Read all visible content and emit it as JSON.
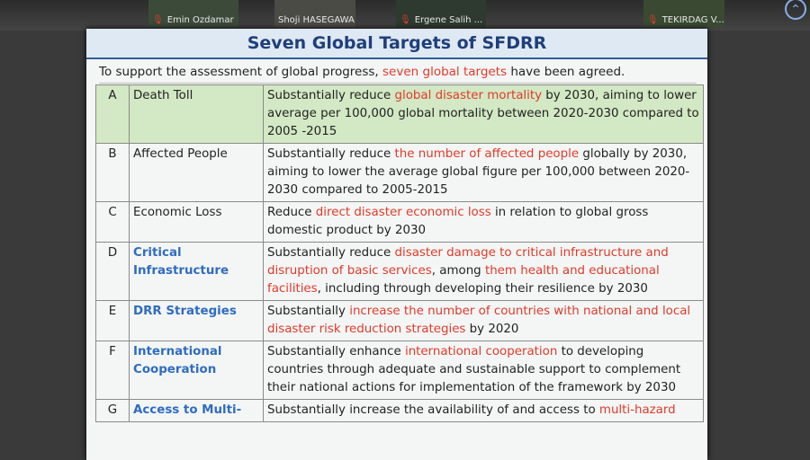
{
  "participants": [
    {
      "name": "Emin Ozdamar"
    },
    {
      "name": "Shoji HASEGAWA"
    },
    {
      "name": "Ergene Salih ..."
    },
    {
      "name": "TEKIRDAG V..."
    }
  ],
  "slide": {
    "title": "Seven Global Targets of SFDRR",
    "subtitle_a": "To support the assessment of global progress, ",
    "subtitle_b": "seven global targets",
    "subtitle_c": " have been agreed.",
    "rows": [
      {
        "letter": "A",
        "name": "Death Toll",
        "parts": [
          [
            "Substantially reduce ",
            ""
          ],
          [
            "global disaster mortality",
            "red"
          ],
          [
            " by 2030, aiming to lower average per 100,000 global mortality between 2020-2030 compared to 2005 -2015",
            ""
          ]
        ]
      },
      {
        "letter": "B",
        "name": "Affected People",
        "parts": [
          [
            "Substantially reduce ",
            ""
          ],
          [
            "the number of affected people",
            "red"
          ],
          [
            " globally by 2030, aiming to lower the average global figure per 100,000 between 2020-2030 compared to 2005-2015",
            ""
          ]
        ]
      },
      {
        "letter": "C",
        "name": "Economic Loss",
        "parts": [
          [
            "Reduce ",
            ""
          ],
          [
            "direct disaster economic loss",
            "red"
          ],
          [
            " in relation to global gross domestic product by 2030",
            ""
          ]
        ]
      },
      {
        "letter": "D",
        "name": "Critical Infrastructure",
        "parts": [
          [
            "Substantially reduce ",
            ""
          ],
          [
            "disaster damage to critical infrastructure and disruption of basic services",
            "red"
          ],
          [
            ", among ",
            ""
          ],
          [
            "them health and educational facilities",
            "red"
          ],
          [
            ", including through developing their resilience by 2030",
            ""
          ]
        ]
      },
      {
        "letter": "E",
        "name": "DRR Strategies",
        "parts": [
          [
            "Substantially ",
            ""
          ],
          [
            "increase the number of countries with national and local disaster risk reduction strategies",
            "red"
          ],
          [
            " by 2020",
            ""
          ]
        ]
      },
      {
        "letter": "F",
        "name": "International Cooperation",
        "parts": [
          [
            "Substantially enhance ",
            ""
          ],
          [
            "international cooperation",
            "red"
          ],
          [
            " to developing countries through adequate and sustainable support to complement their national actions for implementation of the framework by 2030",
            ""
          ]
        ]
      },
      {
        "letter": "G",
        "name": "Access to Multi-",
        "parts": [
          [
            "Substantially increase the availability of and access to ",
            ""
          ],
          [
            "multi-hazard",
            "red"
          ]
        ]
      }
    ]
  }
}
